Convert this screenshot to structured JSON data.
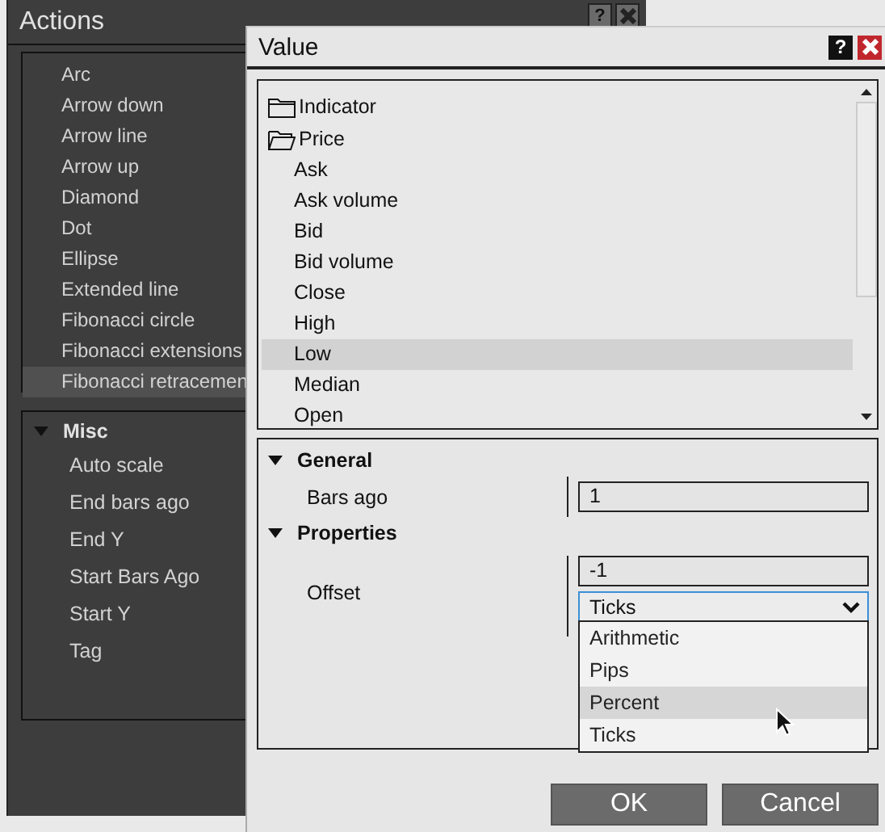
{
  "actions_window": {
    "title": "Actions",
    "help_button": "?",
    "items": [
      {
        "label": "Arc",
        "selected": false
      },
      {
        "label": "Arrow down",
        "selected": false
      },
      {
        "label": "Arrow line",
        "selected": false
      },
      {
        "label": "Arrow up",
        "selected": false
      },
      {
        "label": "Diamond",
        "selected": false
      },
      {
        "label": "Dot",
        "selected": false
      },
      {
        "label": "Ellipse",
        "selected": false
      },
      {
        "label": "Extended line",
        "selected": false
      },
      {
        "label": "Fibonacci circle",
        "selected": false
      },
      {
        "label": "Fibonacci extensions",
        "selected": false
      },
      {
        "label": "Fibonacci retracemen",
        "selected": true
      }
    ],
    "misc": {
      "title": "Misc",
      "expanded": true,
      "items": [
        "Auto scale",
        "End bars ago",
        "End Y",
        "Start Bars Ago",
        "Start Y",
        "Tag"
      ]
    }
  },
  "value_dialog": {
    "title": "Value",
    "help_button": "?",
    "tree": [
      {
        "label": "Indicator",
        "expanded": false
      },
      {
        "label": "Price",
        "expanded": true,
        "children": [
          {
            "label": "Ask",
            "selected": false
          },
          {
            "label": "Ask volume",
            "selected": false
          },
          {
            "label": "Bid",
            "selected": false
          },
          {
            "label": "Bid volume",
            "selected": false
          },
          {
            "label": "Close",
            "selected": false
          },
          {
            "label": "High",
            "selected": false
          },
          {
            "label": "Low",
            "selected": true
          },
          {
            "label": "Median",
            "selected": false
          },
          {
            "label": "Open",
            "selected": false
          }
        ]
      }
    ],
    "categories": [
      {
        "title": "General",
        "expanded": true,
        "properties": [
          {
            "label": "Bars ago",
            "value": "1"
          }
        ]
      },
      {
        "title": "Properties",
        "expanded": true,
        "properties": [
          {
            "label": "Offset",
            "value": "-1",
            "select": "Ticks"
          }
        ]
      }
    ],
    "dropdown": [
      {
        "label": "Arithmetic",
        "highlighted": false
      },
      {
        "label": "Pips",
        "highlighted": false
      },
      {
        "label": "Percent",
        "highlighted": true
      },
      {
        "label": "Ticks",
        "highlighted": false
      }
    ],
    "buttons": [
      "OK",
      "Cancel"
    ]
  }
}
